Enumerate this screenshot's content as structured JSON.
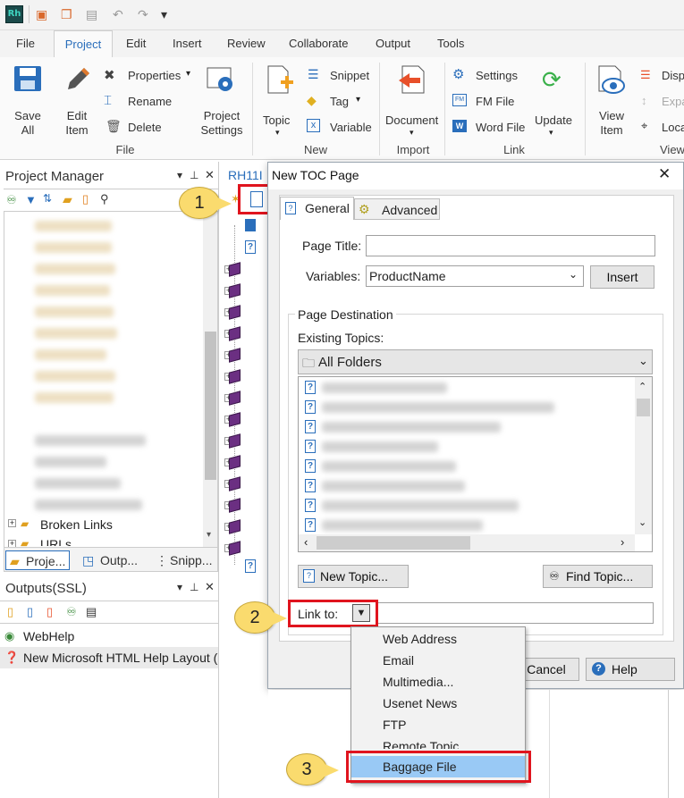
{
  "app": {
    "logo": "Rh"
  },
  "menu_tabs": [
    "File",
    "Project",
    "Edit",
    "Insert",
    "Review",
    "Collaborate",
    "Output",
    "Tools"
  ],
  "ribbon": {
    "save_all": "Save\nAll",
    "edit_item": "Edit\nItem",
    "properties": "Properties",
    "rename": "Rename",
    "delete": "Delete",
    "project_settings": "Project\nSettings",
    "group_file": "File",
    "topic": "Topic",
    "snippet": "Snippet",
    "tag": "Tag",
    "variable": "Variable",
    "group_new": "New",
    "document": "Document",
    "group_import": "Import",
    "settings": "Settings",
    "fm_file": "FM File",
    "word_file": "Word File",
    "update": "Update",
    "group_link": "Link",
    "view_item": "View\nItem",
    "disp": "Disp",
    "expa": "Expa",
    "loca": "Loca",
    "group_view": "View"
  },
  "project_manager": {
    "title": "Project Manager",
    "broken_links": "Broken Links",
    "urls": "URLs",
    "tabs": [
      "Proje...",
      "Outp...",
      "Snipp..."
    ]
  },
  "outputs": {
    "title": "Outputs(SSL)",
    "items": [
      "WebHelp",
      "New Microsoft HTML Help Layout ("
    ]
  },
  "editor": {
    "tab_title": "RH11I"
  },
  "dialog": {
    "title": "New TOC Page",
    "tabs": [
      "General",
      "Advanced"
    ],
    "page_title_label": "Page Title:",
    "page_title_value": "",
    "variables_label": "Variables:",
    "variables_value": "ProductName",
    "insert_button": "Insert",
    "page_destination": "Page Destination",
    "existing_topics": "Existing Topics:",
    "folder_value": "All Folders",
    "new_topic_button": "New Topic...",
    "find_topic_button": "Find Topic...",
    "link_to_label": "Link to:",
    "cancel_button": "Cancel",
    "help_button": "Help"
  },
  "link_menu": [
    "Web Address",
    "Email",
    "Multimedia...",
    "Usenet News",
    "FTP",
    "Remote Topic...",
    "Baggage File"
  ],
  "callouts": [
    "1",
    "2",
    "3"
  ],
  "colors": {
    "highlight_red": "#e0141e",
    "callout_yellow": "#fadb6e",
    "accent_blue": "#2a6ebb",
    "menu_selected": "#99c9f5"
  }
}
